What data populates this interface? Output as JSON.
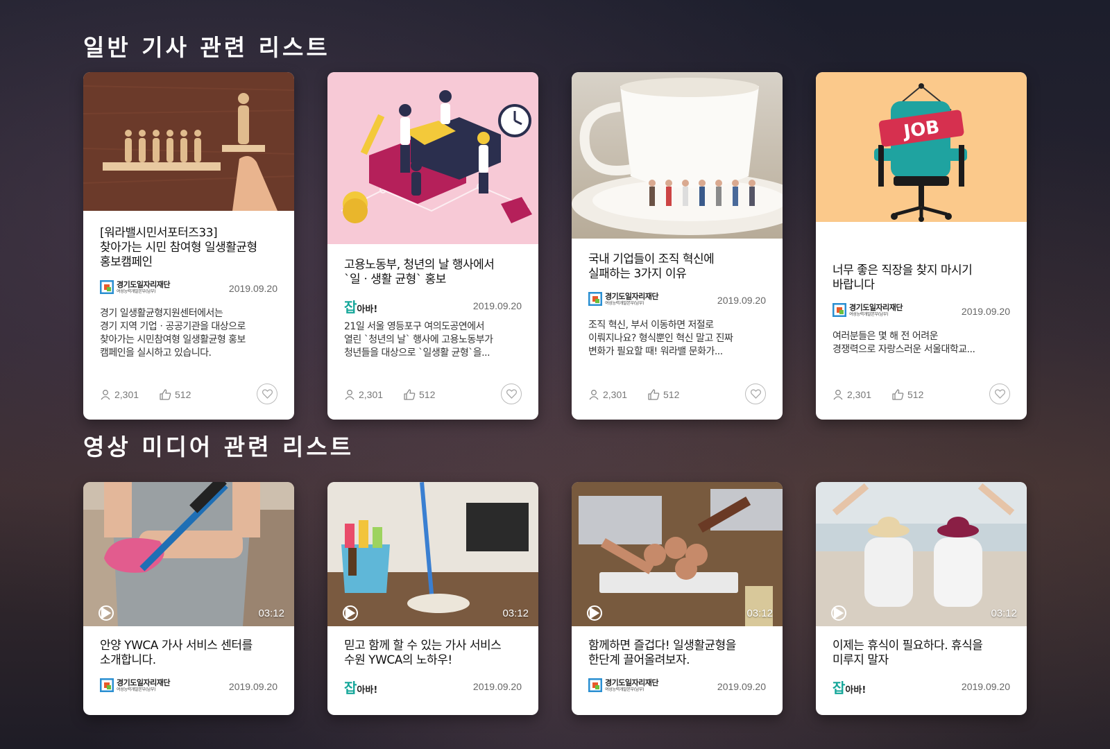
{
  "sections": {
    "articles_title": "일반 기사 관련 리스트",
    "media_title": "영상 미디어 관련 리스트"
  },
  "articles": [
    {
      "title": "[워라밸시민서포터즈33]\n찾아가는 시민 참여형 일생활균형\n홍보캠페인",
      "publisher": "gyeonggi",
      "date": "2019.09.20",
      "description": "경기 일생활균형지원센터에서는\n경기 지역 기업ㆍ공공기관을 대상으로\n찾아가는 시민참여형 일생활균형 홍보\n캠페인을 실시하고 있습니다.",
      "views": "2,301",
      "likes": "512"
    },
    {
      "title": "고용노동부, 청년의 날 행사에서\n`일ㆍ생활 균형` 홍보",
      "publisher": "jobbuy",
      "date": "2019.09.20",
      "description": "21일 서울 영등포구 여의도공연에서\n열린 `청년의 날` 행사에 고용노동부가\n청년들을 대상으로 `일생활 균형`을...",
      "views": "2,301",
      "likes": "512"
    },
    {
      "title": "국내 기업들이 조직 혁신에\n실패하는 3가지 이유",
      "publisher": "gyeonggi",
      "date": "2019.09.20",
      "description": "조직 혁신, 부서 이동하면 저절로\n이뤄지나요? 형식뿐인 혁신 말고 진짜\n변화가 필요할 때! 워라밸 문화가...",
      "views": "2,301",
      "likes": "512"
    },
    {
      "title": "너무 좋은 직장을 찾지 마시기\n바랍니다",
      "publisher": "gyeonggi",
      "date": "2019.09.20",
      "description": "여러분들은 몇 해 전 어려운\n경쟁력으로 자랑스러운 서울대학교...",
      "views": "2,301",
      "likes": "512",
      "thumb_sign": "JOB"
    }
  ],
  "videos": [
    {
      "title": "안양 YWCA 가사 서비스 센터를\n소개합니다.",
      "publisher": "gyeonggi",
      "date": "2019.09.20",
      "duration": "03:12"
    },
    {
      "title": "믿고 함께 할 수 있는 가사 서비스\n수원 YWCA의 노하우!",
      "publisher": "jobbuy",
      "date": "2019.09.20",
      "duration": "03:12"
    },
    {
      "title": "함께하면 즐겁다! 일생활균형을\n한단계 끌어올려보자.",
      "publisher": "gyeonggi",
      "date": "2019.09.20",
      "duration": "03:12"
    },
    {
      "title": "이제는 휴식이 필요하다. 휴식을\n미루지 말자",
      "publisher": "jobbuy",
      "date": "2019.09.20",
      "duration": "03:12"
    }
  ],
  "logos": {
    "gyeonggi_name": "경기도일자리재단",
    "gyeonggi_sub": "여성능력개발본부(남부)",
    "jobbuy_j": "잡",
    "jobbuy_rest": "아바!"
  },
  "colors": {
    "accent_teal": "#16a79a",
    "job_sign": "#d6304f"
  }
}
